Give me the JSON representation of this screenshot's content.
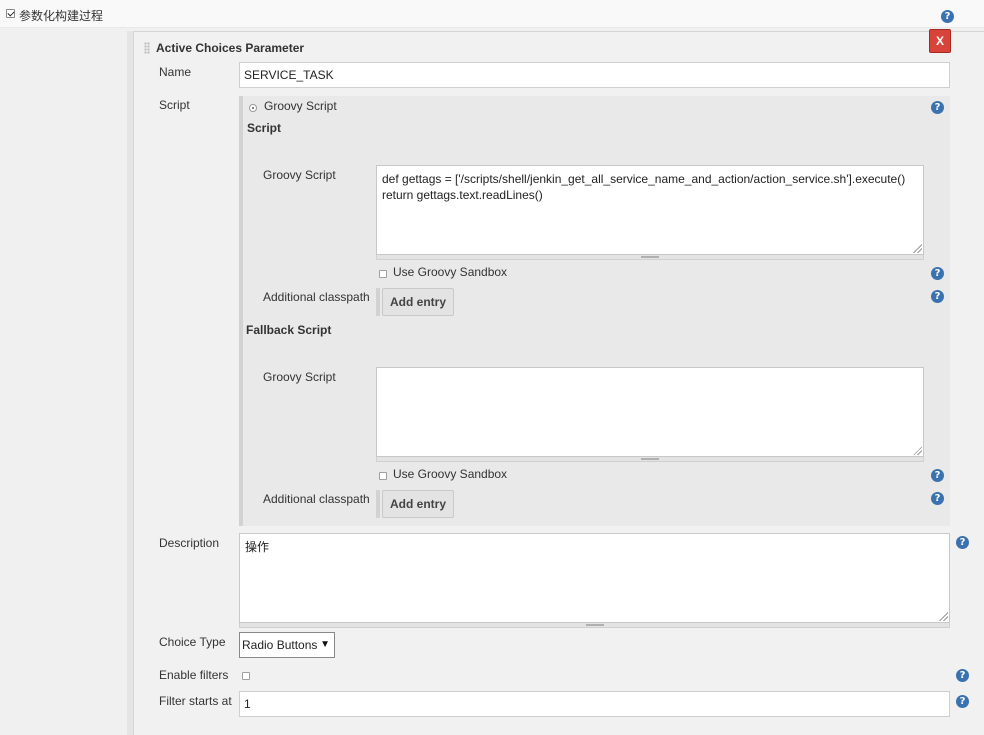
{
  "header": {
    "checkbox_checked": true,
    "label": "参数化构建过程"
  },
  "parameter": {
    "title": "Active Choices Parameter",
    "delete_label": "X",
    "name_label": "Name",
    "name_value": "SERVICE_TASK",
    "script_label": "Script",
    "script_type_option": "Groovy Script",
    "script_section_title": "Script",
    "groovy_script_label": "Groovy Script",
    "groovy_script_code": "def gettags = ['/scripts/shell/jenkin_get_all_service_name_and_action/action_service.sh'].execute()\nreturn gettags.text.readLines()",
    "use_sandbox_label": "Use Groovy Sandbox",
    "use_sandbox_checked": false,
    "classpath_label": "Additional classpath",
    "add_entry_label": "Add entry",
    "fallback_title": "Fallback Script",
    "fallback_groovy_label": "Groovy Script",
    "fallback_code": "",
    "fallback_sandbox_label": "Use Groovy Sandbox",
    "fallback_sandbox_checked": false,
    "fallback_classpath_label": "Additional classpath",
    "fallback_add_entry_label": "Add entry",
    "description_label": "Description",
    "description_value": "操作",
    "choice_type_label": "Choice Type",
    "choice_type_value": "Radio Buttons",
    "enable_filters_label": "Enable filters",
    "enable_filters_checked": false,
    "filter_starts_label": "Filter starts at",
    "filter_starts_value": "1"
  },
  "icons": {
    "help": "?",
    "dropdown": "▼"
  },
  "colors": {
    "help_icon": "#3a72b0",
    "delete_button": "#d9443a",
    "panel_background": "#f1f1f1"
  }
}
